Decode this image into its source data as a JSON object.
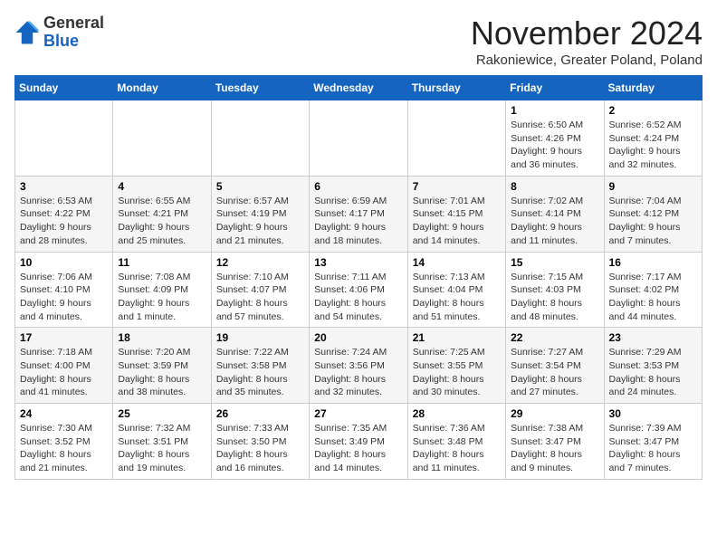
{
  "logo": {
    "general": "General",
    "blue": "Blue"
  },
  "title": {
    "month": "November 2024",
    "location": "Rakoniewice, Greater Poland, Poland"
  },
  "days_header": [
    "Sunday",
    "Monday",
    "Tuesday",
    "Wednesday",
    "Thursday",
    "Friday",
    "Saturday"
  ],
  "weeks": [
    [
      {
        "day": "",
        "info": ""
      },
      {
        "day": "",
        "info": ""
      },
      {
        "day": "",
        "info": ""
      },
      {
        "day": "",
        "info": ""
      },
      {
        "day": "",
        "info": ""
      },
      {
        "day": "1",
        "info": "Sunrise: 6:50 AM\nSunset: 4:26 PM\nDaylight: 9 hours and 36 minutes."
      },
      {
        "day": "2",
        "info": "Sunrise: 6:52 AM\nSunset: 4:24 PM\nDaylight: 9 hours and 32 minutes."
      }
    ],
    [
      {
        "day": "3",
        "info": "Sunrise: 6:53 AM\nSunset: 4:22 PM\nDaylight: 9 hours and 28 minutes."
      },
      {
        "day": "4",
        "info": "Sunrise: 6:55 AM\nSunset: 4:21 PM\nDaylight: 9 hours and 25 minutes."
      },
      {
        "day": "5",
        "info": "Sunrise: 6:57 AM\nSunset: 4:19 PM\nDaylight: 9 hours and 21 minutes."
      },
      {
        "day": "6",
        "info": "Sunrise: 6:59 AM\nSunset: 4:17 PM\nDaylight: 9 hours and 18 minutes."
      },
      {
        "day": "7",
        "info": "Sunrise: 7:01 AM\nSunset: 4:15 PM\nDaylight: 9 hours and 14 minutes."
      },
      {
        "day": "8",
        "info": "Sunrise: 7:02 AM\nSunset: 4:14 PM\nDaylight: 9 hours and 11 minutes."
      },
      {
        "day": "9",
        "info": "Sunrise: 7:04 AM\nSunset: 4:12 PM\nDaylight: 9 hours and 7 minutes."
      }
    ],
    [
      {
        "day": "10",
        "info": "Sunrise: 7:06 AM\nSunset: 4:10 PM\nDaylight: 9 hours and 4 minutes."
      },
      {
        "day": "11",
        "info": "Sunrise: 7:08 AM\nSunset: 4:09 PM\nDaylight: 9 hours and 1 minute."
      },
      {
        "day": "12",
        "info": "Sunrise: 7:10 AM\nSunset: 4:07 PM\nDaylight: 8 hours and 57 minutes."
      },
      {
        "day": "13",
        "info": "Sunrise: 7:11 AM\nSunset: 4:06 PM\nDaylight: 8 hours and 54 minutes."
      },
      {
        "day": "14",
        "info": "Sunrise: 7:13 AM\nSunset: 4:04 PM\nDaylight: 8 hours and 51 minutes."
      },
      {
        "day": "15",
        "info": "Sunrise: 7:15 AM\nSunset: 4:03 PM\nDaylight: 8 hours and 48 minutes."
      },
      {
        "day": "16",
        "info": "Sunrise: 7:17 AM\nSunset: 4:02 PM\nDaylight: 8 hours and 44 minutes."
      }
    ],
    [
      {
        "day": "17",
        "info": "Sunrise: 7:18 AM\nSunset: 4:00 PM\nDaylight: 8 hours and 41 minutes."
      },
      {
        "day": "18",
        "info": "Sunrise: 7:20 AM\nSunset: 3:59 PM\nDaylight: 8 hours and 38 minutes."
      },
      {
        "day": "19",
        "info": "Sunrise: 7:22 AM\nSunset: 3:58 PM\nDaylight: 8 hours and 35 minutes."
      },
      {
        "day": "20",
        "info": "Sunrise: 7:24 AM\nSunset: 3:56 PM\nDaylight: 8 hours and 32 minutes."
      },
      {
        "day": "21",
        "info": "Sunrise: 7:25 AM\nSunset: 3:55 PM\nDaylight: 8 hours and 30 minutes."
      },
      {
        "day": "22",
        "info": "Sunrise: 7:27 AM\nSunset: 3:54 PM\nDaylight: 8 hours and 27 minutes."
      },
      {
        "day": "23",
        "info": "Sunrise: 7:29 AM\nSunset: 3:53 PM\nDaylight: 8 hours and 24 minutes."
      }
    ],
    [
      {
        "day": "24",
        "info": "Sunrise: 7:30 AM\nSunset: 3:52 PM\nDaylight: 8 hours and 21 minutes."
      },
      {
        "day": "25",
        "info": "Sunrise: 7:32 AM\nSunset: 3:51 PM\nDaylight: 8 hours and 19 minutes."
      },
      {
        "day": "26",
        "info": "Sunrise: 7:33 AM\nSunset: 3:50 PM\nDaylight: 8 hours and 16 minutes."
      },
      {
        "day": "27",
        "info": "Sunrise: 7:35 AM\nSunset: 3:49 PM\nDaylight: 8 hours and 14 minutes."
      },
      {
        "day": "28",
        "info": "Sunrise: 7:36 AM\nSunset: 3:48 PM\nDaylight: 8 hours and 11 minutes."
      },
      {
        "day": "29",
        "info": "Sunrise: 7:38 AM\nSunset: 3:47 PM\nDaylight: 8 hours and 9 minutes."
      },
      {
        "day": "30",
        "info": "Sunrise: 7:39 AM\nSunset: 3:47 PM\nDaylight: 8 hours and 7 minutes."
      }
    ]
  ]
}
